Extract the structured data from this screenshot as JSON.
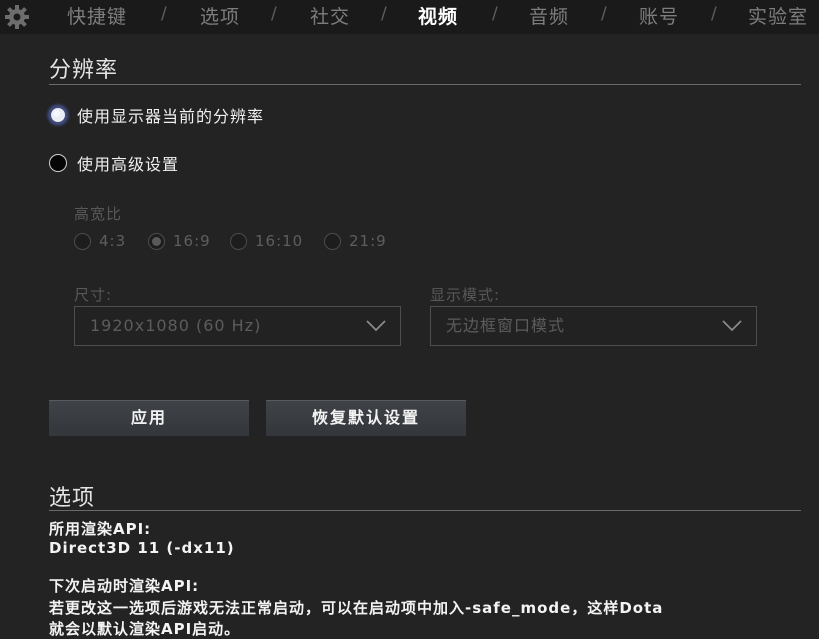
{
  "nav": {
    "tabs": [
      "快捷键",
      "选项",
      "社交",
      "视频",
      "音频",
      "账号",
      "实验室"
    ],
    "active_tab": "视频",
    "separator": "/"
  },
  "resolution": {
    "title": "分辨率",
    "option_current": "使用显示器当前的分辨率",
    "option_advanced": "使用高级设置",
    "selected": "使用显示器当前的分辨率",
    "aspect_label": "高宽比",
    "aspect_ratios": [
      "4:3",
      "16:9",
      "16:10",
      "21:9"
    ],
    "aspect_selected": "16:9",
    "size_label": "尺寸:",
    "size_value": "1920x1080 (60 Hz)",
    "display_mode_label": "显示模式:",
    "display_mode_value": "无边框窗口模式"
  },
  "buttons": {
    "apply": "应用",
    "restore_defaults": "恢复默认设置"
  },
  "options": {
    "title": "选项",
    "render_api_label": "所用渲染API:",
    "render_api_value": "Direct3D 11 (-dx11)",
    "next_api_label": "下次启动时渲染API:",
    "next_api_note_1": "若更改这一选项后游戏无法正常启动，可以在启动项中加入-safe_mode，这样Dota",
    "next_api_note_2": "就会以默认渲染API启动。"
  },
  "colors": {
    "background": "#232323",
    "topbar": "#1a1a1a",
    "active_tab": "#ffffff",
    "inactive_tab": "#7d7d7d",
    "button": "#3a3e42",
    "radio_glow": "#4b5aa0"
  }
}
